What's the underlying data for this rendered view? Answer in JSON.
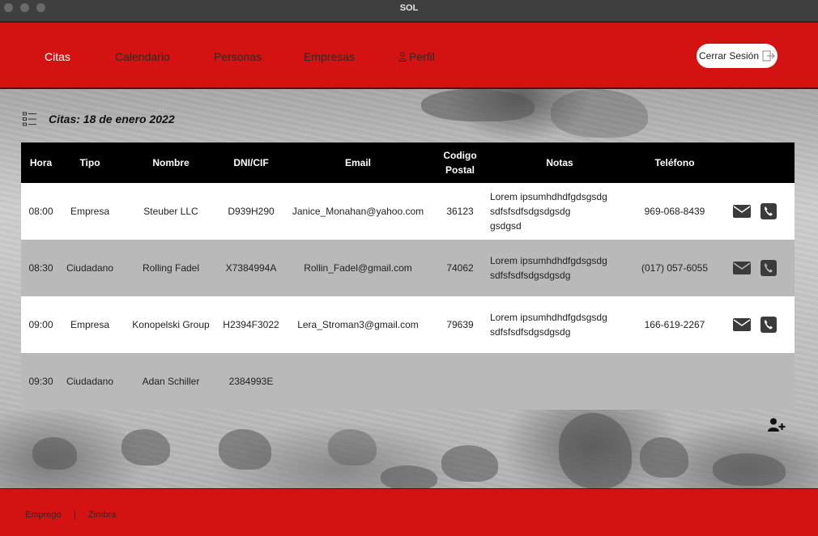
{
  "window": {
    "title": "SOL"
  },
  "nav": {
    "items": [
      {
        "label": "Citas",
        "active": true
      },
      {
        "label": "Calendario",
        "active": false
      },
      {
        "label": "Personas",
        "active": false
      },
      {
        "label": "Empresas",
        "active": false
      },
      {
        "label": "Perfil",
        "icon": "user-icon",
        "active": false
      }
    ],
    "logout_label": "Cerrar Sesión",
    "logout_icon": "logout-icon"
  },
  "page": {
    "heading": "Citas: 18 de enero 2022",
    "heading_icon": "list-icon"
  },
  "table": {
    "columns": [
      "Hora",
      "Tipo",
      "Nombre",
      "DNI/CIF",
      "Email",
      "Codigo Postal",
      "Notas",
      "Teléfono"
    ],
    "rows": [
      {
        "hora": "08:00",
        "tipo": "Empresa",
        "nombre": "Steuber LLC",
        "dni": "D939H290",
        "email": "Janice_Monahan@yahoo.com",
        "cp": "36123",
        "notas": "Lorem ipsumhdhdfgdsgsdg\nsdfsfsdfsdgsdgsdg\ngsdgsd",
        "telefono": "969-068-8439",
        "actions": [
          "email-icon",
          "phone-icon"
        ]
      },
      {
        "hora": "08:30",
        "tipo": "Ciudadano",
        "nombre": "Rolling Fadel",
        "dni": "X7384994A",
        "email": "Rollin_Fadel@gmail.com",
        "cp": "74062",
        "notas": "Lorem ipsumhdhdfgdsgsdg\nsdfsfsdfsdgsdgsdg",
        "telefono": "(017) 057-6055",
        "actions": [
          "email-icon",
          "phone-icon"
        ]
      },
      {
        "hora": "09:00",
        "tipo": "Empresa",
        "nombre": "Konopelski Group",
        "dni": "H2394F3022",
        "email": "Lera_Stroman3@gmail.com",
        "cp": "79639",
        "notas": "Lorem ipsumhdhdfgdsgsdg\nsdfsfsdfsdgsdgsdg",
        "telefono": "166-619-2267",
        "actions": [
          "email-icon",
          "phone-icon"
        ]
      },
      {
        "hora": "09:30",
        "tipo": "Ciudadano",
        "nombre": "Adan Schiller",
        "dni": "2384993E",
        "email": "",
        "cp": "",
        "notas": "",
        "telefono": "",
        "actions": []
      }
    ],
    "add_icon": "add-user-icon"
  },
  "footer": {
    "links": [
      "Emprego",
      "Zimbra"
    ],
    "separator": "|"
  },
  "colors": {
    "brand_red": "#d41212",
    "header_black": "#000000",
    "row_alt": "#b9b9b9"
  }
}
